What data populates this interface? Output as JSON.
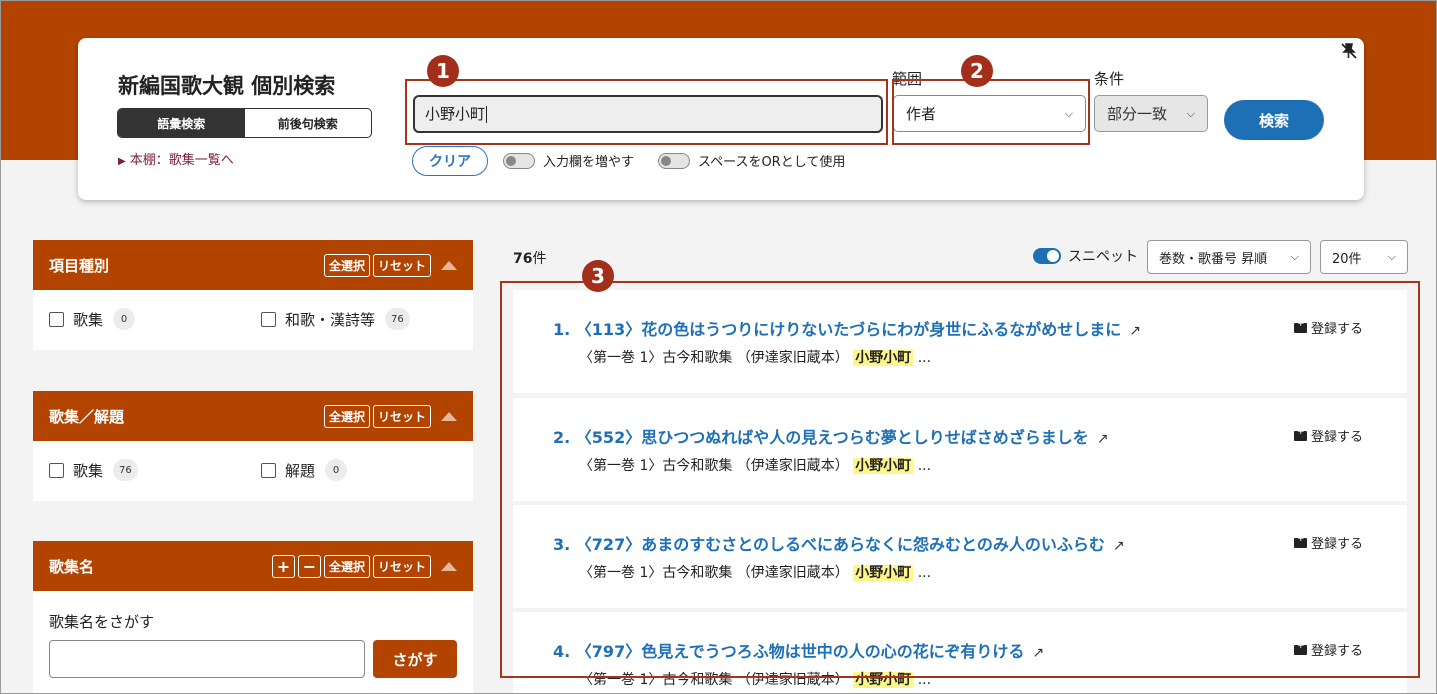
{
  "header": {
    "title": "新編国歌大観 個別検索",
    "modes": [
      "語彙検索",
      "前後句検索"
    ],
    "active_mode": "語彙検索",
    "book_link": "本棚：歌集一覧へ",
    "query_value": "小野小町",
    "clear_label": "クリア",
    "toggle_more_inputs": "入力欄を増やす",
    "toggle_space_or": "スペースをORとして使用",
    "range_label": "範囲",
    "range_value": "作者",
    "cond_label": "条件",
    "cond_value": "部分一致",
    "search_label": "検索",
    "pin_icon": "pin-slash-icon"
  },
  "annotations": [
    "1",
    "2",
    "3"
  ],
  "panels": {
    "item_type": {
      "title": "項目種別",
      "btn_all": "全選択",
      "btn_reset": "リセット",
      "options": [
        {
          "label": "歌集",
          "count": "0"
        },
        {
          "label": "和歌・漢詩等",
          "count": "76"
        }
      ]
    },
    "collection": {
      "title": "歌集／解題",
      "btn_all": "全選択",
      "btn_reset": "リセット",
      "options": [
        {
          "label": "歌集",
          "count": "76"
        },
        {
          "label": "解題",
          "count": "0"
        }
      ]
    },
    "collection_name": {
      "title": "歌集名",
      "btn_plus": "+",
      "btn_minus": "−",
      "btn_all": "全選択",
      "btn_reset": "リセット",
      "search_label": "歌集名をさがす",
      "search_button": "さがす"
    }
  },
  "results": {
    "count_num": "76",
    "count_unit": "件",
    "snippet_label": "スニペット",
    "sort_value": "巻数・歌番号 昇順",
    "per_page_value": "20件",
    "register_label": "登録する",
    "items": [
      {
        "num": "1.",
        "title": "〈113〉花の色はうつりにけりないたづらにわが身世にふるながめせしまに",
        "sub": "〈第一巻 1〉古今和歌集 （伊達家旧蔵本）",
        "hl": "小野小町",
        "tail": "..."
      },
      {
        "num": "2.",
        "title": "〈552〉思ひつつぬればや人の見えつらむ夢としりせばさめざらましを",
        "sub": "〈第一巻 1〉古今和歌集 （伊達家旧蔵本）",
        "hl": "小野小町",
        "tail": "..."
      },
      {
        "num": "3.",
        "title": "〈727〉あまのすむさとのしるべにあらなくに怨みむとのみ人のいふらむ",
        "sub": "〈第一巻 1〉古今和歌集 （伊達家旧蔵本）",
        "hl": "小野小町",
        "tail": "..."
      },
      {
        "num": "4.",
        "title": "〈797〉色見えでうつろふ物は世中の人の心の花にぞ有りける",
        "sub": "〈第一巻 1〉古今和歌集 （伊達家旧蔵本）",
        "hl": "小野小町",
        "tail": "..."
      }
    ]
  }
}
